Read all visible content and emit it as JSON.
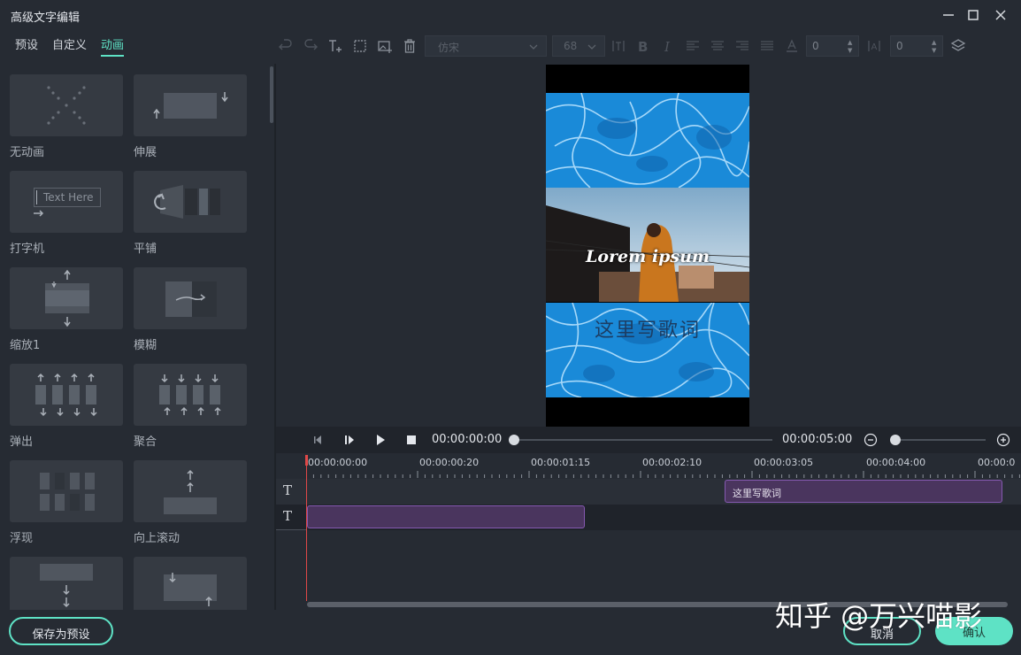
{
  "window": {
    "title": "高级文字编辑",
    "controls": [
      "minimize-icon",
      "maximize-icon",
      "close-icon"
    ]
  },
  "tabs": [
    {
      "label": "预设",
      "active": false
    },
    {
      "label": "自定义",
      "active": false
    },
    {
      "label": "动画",
      "active": true
    }
  ],
  "toolbar": {
    "font_family": "仿宋",
    "font_size": "68",
    "char_spacing": "0",
    "line_spacing": "0"
  },
  "presets": [
    {
      "label": "无动画",
      "icon": "no-animation-icon"
    },
    {
      "label": "伸展",
      "icon": "stretch-icon"
    },
    {
      "label": "打字机",
      "icon": "typewriter-icon",
      "thumb_text": "Text Here"
    },
    {
      "label": "平铺",
      "icon": "tile-icon"
    },
    {
      "label": "缩放1",
      "icon": "zoom-icon"
    },
    {
      "label": "模糊",
      "icon": "blur-icon"
    },
    {
      "label": "弹出",
      "icon": "pop-out-icon"
    },
    {
      "label": "聚合",
      "icon": "gather-icon"
    },
    {
      "label": "浮现",
      "icon": "emerge-icon"
    },
    {
      "label": "向上滚动",
      "icon": "scroll-up-icon"
    },
    {
      "label": "",
      "icon": "drop-down-icon"
    },
    {
      "label": "",
      "icon": "slide-icon"
    }
  ],
  "preview": {
    "overlay_text": "Lorem ipsum",
    "lyric_text": "这里写歌词"
  },
  "playback": {
    "current_time": "00:00:00:00",
    "total_time": "00:00:05:00"
  },
  "timeline": {
    "ruler": [
      "00:00:00:00",
      "00:00:00:20",
      "00:00:01:15",
      "00:00:02:10",
      "00:00:03:05",
      "00:00:04:00",
      "00:00:0"
    ],
    "tracks": [
      {
        "icon": "T",
        "clip_label": "这里写歌词"
      },
      {
        "icon": "T",
        "clip_label": ""
      }
    ]
  },
  "footer": {
    "save_preset": "保存为预设",
    "cancel": "取消",
    "confirm": "确认",
    "watermark": "知乎 @万兴喵影"
  },
  "colors": {
    "accent": "#5ee2c5",
    "background": "#262b33",
    "clip": "#4a355e",
    "clip_border": "#8559b0",
    "playhead": "#e04848"
  }
}
